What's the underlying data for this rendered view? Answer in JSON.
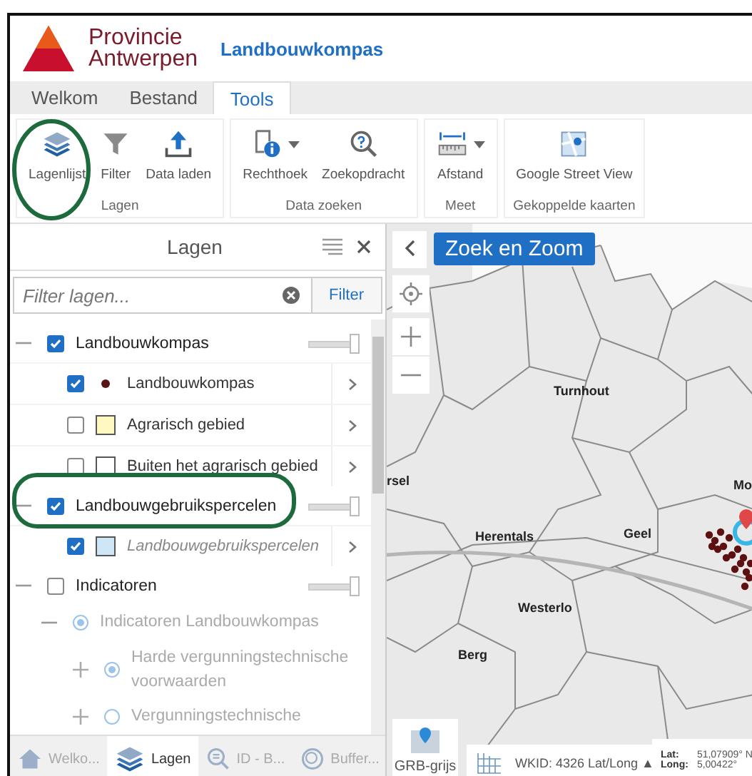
{
  "header": {
    "org_name": [
      "Provincie",
      "Antwerpen"
    ],
    "app_title": "Landbouwkompas"
  },
  "tabs": [
    {
      "label": "Welkom",
      "selected": false
    },
    {
      "label": "Bestand",
      "selected": false
    },
    {
      "label": "Tools",
      "selected": true
    }
  ],
  "ribbon": [
    {
      "label": "Lagen",
      "buttons": [
        {
          "label": "Lagenlijst",
          "dropdown": false
        },
        {
          "label": "Filter",
          "dropdown": false
        },
        {
          "label": "Data laden",
          "dropdown": false
        }
      ]
    },
    {
      "label": "Data zoeken",
      "buttons": [
        {
          "label": "Rechthoek",
          "dropdown": true
        },
        {
          "label": "Zoekopdracht",
          "dropdown": false
        }
      ]
    },
    {
      "label": "Meet",
      "buttons": [
        {
          "label": "Afstand",
          "dropdown": true
        }
      ]
    },
    {
      "label": "Gekoppelde kaarten",
      "buttons": [
        {
          "label": "Google Street View",
          "dropdown": false
        }
      ]
    }
  ],
  "panel": {
    "title": "Lagen",
    "filter": {
      "placeholder": "Filter lagen...",
      "button": "Filter"
    },
    "layers": [
      {
        "label": "Landbouwkompas",
        "checked": true,
        "expanded": true,
        "level": 1,
        "children": [
          {
            "kind": "point",
            "label": "Landbouwkompas",
            "checked": true,
            "color": "#5a1414",
            "out_of_scale": false
          },
          {
            "kind": "polygon",
            "label": "Agrarisch gebied",
            "checked": false,
            "color": "#fff8c0",
            "out_of_scale": false
          },
          {
            "kind": "polygon",
            "label": "Buiten het agrarisch gebied",
            "checked": false,
            "color": "#ffffff",
            "out_of_scale": false
          }
        ]
      },
      {
        "label": "Landbouwgebruikspercelen",
        "checked": true,
        "expanded": true,
        "level": 1,
        "children": [
          {
            "kind": "polygon",
            "label": "Landbouwgebruikspercelen",
            "checked": true,
            "color": "#cfe6f7",
            "out_of_scale": true
          }
        ]
      },
      {
        "label": "Indicatoren",
        "checked": false,
        "expanded": true,
        "level": 1,
        "children": [
          {
            "kind": "radio",
            "label": "Indicatoren Landbouwkompas",
            "selected": true,
            "expanded": true,
            "disabled": true,
            "children": [
              {
                "kind": "radio",
                "label": "Harde vergunningstechnische voorwaarden",
                "selected": true,
                "expanded": false,
                "disabled": true
              },
              {
                "kind": "radio",
                "label": "Vergunningstechnische",
                "selected": false,
                "expanded": false,
                "disabled": true
              }
            ]
          }
        ]
      }
    ],
    "bottom_tabs": [
      {
        "label": "Welko...",
        "selected": false
      },
      {
        "label": "Lagen",
        "selected": true
      },
      {
        "label": "ID - B...",
        "selected": false
      },
      {
        "label": "Buffer...",
        "selected": false
      }
    ]
  },
  "map": {
    "search_button": "Zoek en Zoom",
    "labels": [
      {
        "text": "Turnhout"
      },
      {
        "text": "rsel"
      },
      {
        "text": "Herentals"
      },
      {
        "text": "Geel"
      },
      {
        "text": "Westerlo"
      },
      {
        "text": "Berg"
      },
      {
        "text": "Mo"
      }
    ],
    "basemap": "GRB-grijs",
    "projection": "WKID: 4326 Lat/Long ▲",
    "lat_label": "Lat:",
    "lat": "51,07909° N",
    "long_label": "Long:",
    "long": "5,00422°"
  }
}
